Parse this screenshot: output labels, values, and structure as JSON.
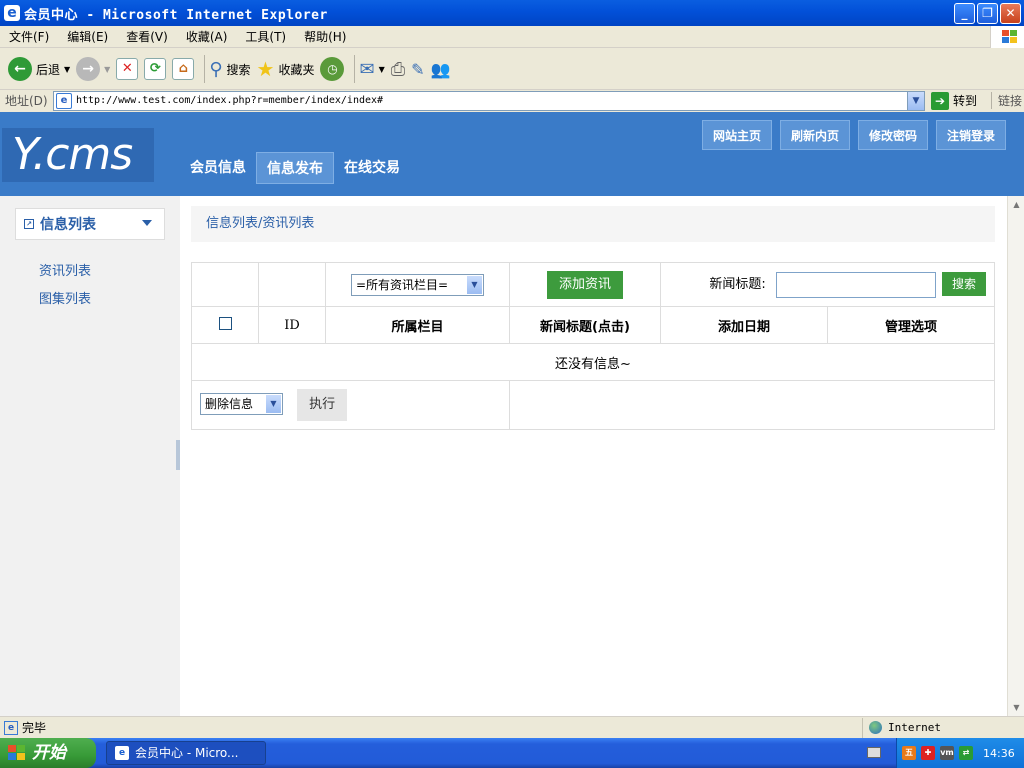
{
  "window": {
    "title": "会员中心 - Microsoft Internet Explorer"
  },
  "menu": [
    "文件(F)",
    "编辑(E)",
    "查看(V)",
    "收藏(A)",
    "工具(T)",
    "帮助(H)"
  ],
  "toolbar": {
    "back_label": "后退",
    "search_label": "搜索",
    "favorites_label": "收藏夹"
  },
  "address": {
    "label": "地址(D)",
    "url": "http://www.test.com/index.php?r=member/index/index#",
    "go_label": "转到",
    "links_label": "链接"
  },
  "site": {
    "logo": "Y.cms",
    "nav": [
      "会员信息",
      "信息发布",
      "在线交易"
    ],
    "active_nav": "信息发布",
    "top_buttons": [
      "网站主页",
      "刷新内页",
      "修改密码",
      "注销登录"
    ]
  },
  "sidebar": {
    "heading": "信息列表",
    "links": [
      "资讯列表",
      "图集列表"
    ]
  },
  "content": {
    "breadcrumb": "信息列表/资讯列表",
    "category_select": "=所有资讯栏目=",
    "add_button": "添加资讯",
    "search_label": "新闻标题:",
    "search_value": "",
    "search_button": "搜索",
    "columns": [
      "ID",
      "所属栏目",
      "新闻标题(点击)",
      "添加日期",
      "管理选项"
    ],
    "empty_message": "还没有信息~",
    "action_select": "删除信息",
    "execute_button": "执行"
  },
  "status": {
    "text": "完毕",
    "zone": "Internet"
  },
  "taskbar": {
    "start_label": "开始",
    "task_label": "会员中心 - Micro...",
    "clock": "14:36"
  },
  "colors": {
    "header_blue": "#3a7bc8",
    "link_blue": "#2a5fa8",
    "button_green": "#3d9b3d"
  }
}
